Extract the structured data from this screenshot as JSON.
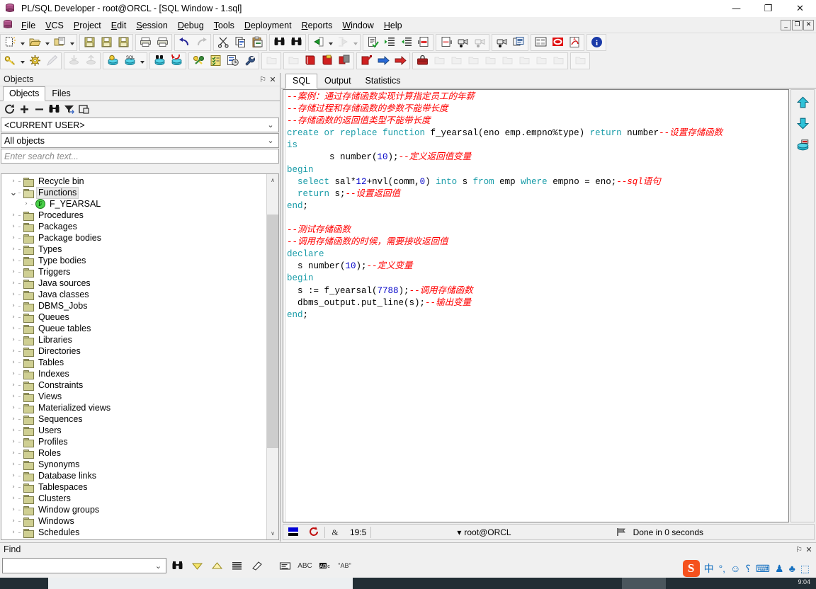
{
  "window": {
    "title": "PL/SQL Developer - root@ORCL - [SQL Window - 1.sql]",
    "minimize": "—",
    "maximize": "❐",
    "close": "✕",
    "mdi_restore": "_",
    "mdi_max": "❐",
    "mdi_close": "✕"
  },
  "menu": [
    {
      "label": "File",
      "accel": "F"
    },
    {
      "label": "VCS",
      "accel": "V"
    },
    {
      "label": "Project",
      "accel": "P"
    },
    {
      "label": "Edit",
      "accel": "E"
    },
    {
      "label": "Session",
      "accel": "S"
    },
    {
      "label": "Debug",
      "accel": "D"
    },
    {
      "label": "Tools",
      "accel": "T"
    },
    {
      "label": "Deployment",
      "accel": "D"
    },
    {
      "label": "Reports",
      "accel": "R"
    },
    {
      "label": "Window",
      "accel": "W"
    },
    {
      "label": "Help",
      "accel": "H"
    }
  ],
  "toolbar_row1": [
    {
      "name": "new-window-icon",
      "enabled": true,
      "dropdown": true
    },
    {
      "name": "open-folder-icon",
      "enabled": true,
      "dropdown": true
    },
    {
      "name": "open-recent-icon",
      "enabled": true,
      "dropdown": true
    },
    {
      "name": "save-icon",
      "enabled": true,
      "dropdown": false
    },
    {
      "name": "save-as-icon",
      "enabled": true,
      "dropdown": false
    },
    {
      "name": "save-all-icon",
      "enabled": true,
      "dropdown": false
    },
    {
      "name": "print-icon",
      "enabled": true,
      "dropdown": false
    },
    {
      "name": "print-setup-icon",
      "enabled": true,
      "dropdown": false
    },
    {
      "name": "undo-icon",
      "enabled": true,
      "dropdown": false
    },
    {
      "name": "redo-icon",
      "enabled": false,
      "dropdown": false
    },
    {
      "name": "cut-icon",
      "enabled": true,
      "dropdown": false
    },
    {
      "name": "copy-icon",
      "enabled": true,
      "dropdown": false
    },
    {
      "name": "paste-icon",
      "enabled": true,
      "dropdown": false
    },
    {
      "name": "find-icon",
      "enabled": true,
      "dropdown": false
    },
    {
      "name": "find-next-icon",
      "enabled": true,
      "dropdown": false
    },
    {
      "name": "previous-window-icon",
      "enabled": true,
      "dropdown": true
    },
    {
      "name": "next-window-icon",
      "enabled": false,
      "dropdown": true
    },
    {
      "name": "syntax-check-icon",
      "enabled": true,
      "dropdown": false
    },
    {
      "name": "indent-icon",
      "enabled": true,
      "dropdown": false
    },
    {
      "name": "unindent-icon",
      "enabled": true,
      "dropdown": false
    },
    {
      "name": "comment-icon",
      "enabled": true,
      "dropdown": false
    },
    {
      "name": "uncomment-icon",
      "enabled": true,
      "dropdown": false
    },
    {
      "name": "record-macro-icon",
      "enabled": true,
      "dropdown": false
    },
    {
      "name": "pause-macro-icon",
      "enabled": false,
      "dropdown": false
    },
    {
      "name": "play-macro-icon",
      "enabled": true,
      "dropdown": false
    },
    {
      "name": "window-list-icon",
      "enabled": true,
      "dropdown": false
    },
    {
      "name": "window-tile-icon",
      "enabled": true,
      "dropdown": false
    },
    {
      "name": "stop-icon",
      "enabled": true,
      "dropdown": false
    },
    {
      "name": "pdf-export-icon",
      "enabled": true,
      "dropdown": false
    },
    {
      "name": "about-info-icon",
      "enabled": true,
      "dropdown": false
    }
  ],
  "toolbar_row2": [
    {
      "name": "login-key-icon",
      "enabled": true,
      "dropdown": true
    },
    {
      "name": "preferences-gear-icon",
      "enabled": true,
      "dropdown": false
    },
    {
      "name": "brush-icon",
      "enabled": false,
      "dropdown": false
    },
    {
      "name": "import-icon",
      "enabled": false,
      "dropdown": false
    },
    {
      "name": "export-icon",
      "enabled": false,
      "dropdown": false
    },
    {
      "name": "new-sql-window-icon",
      "enabled": true,
      "dropdown": false
    },
    {
      "name": "sql-window-icon",
      "enabled": true,
      "dropdown": true
    },
    {
      "name": "explain-plan-icon",
      "enabled": true,
      "dropdown": false
    },
    {
      "name": "rollback-icon",
      "enabled": true,
      "dropdown": false
    },
    {
      "name": "compare-icon",
      "enabled": true,
      "dropdown": false
    },
    {
      "name": "test-script-icon",
      "enabled": true,
      "dropdown": false
    },
    {
      "name": "session-history-icon",
      "enabled": true,
      "dropdown": false
    },
    {
      "name": "tools-wrench-icon",
      "enabled": true,
      "dropdown": false
    },
    {
      "name": "new-object-icon",
      "enabled": false,
      "dropdown": false
    },
    {
      "name": "browse-object-icon",
      "enabled": false,
      "dropdown": false
    },
    {
      "name": "red-book1-icon",
      "enabled": true,
      "dropdown": false
    },
    {
      "name": "red-book2-icon",
      "enabled": true,
      "dropdown": false
    },
    {
      "name": "red-book3-icon",
      "enabled": true,
      "dropdown": false
    },
    {
      "name": "red-book4-icon",
      "enabled": true,
      "dropdown": false
    },
    {
      "name": "step-forward-blue-icon",
      "enabled": true,
      "dropdown": false
    },
    {
      "name": "step-forward-red-icon",
      "enabled": true,
      "dropdown": false
    },
    {
      "name": "toolbox-icon",
      "enabled": true,
      "dropdown": false
    },
    {
      "name": "folder-op1-icon",
      "enabled": false,
      "dropdown": false
    },
    {
      "name": "folder-op2-icon",
      "enabled": false,
      "dropdown": false
    },
    {
      "name": "folder-op3-icon",
      "enabled": false,
      "dropdown": false
    },
    {
      "name": "folder-op4-icon",
      "enabled": false,
      "dropdown": false
    },
    {
      "name": "folder-op5-icon",
      "enabled": false,
      "dropdown": false
    },
    {
      "name": "folder-op6-icon",
      "enabled": false,
      "dropdown": false
    },
    {
      "name": "folder-op7-icon",
      "enabled": false,
      "dropdown": false
    },
    {
      "name": "folder-op8-icon",
      "enabled": false,
      "dropdown": false
    },
    {
      "name": "folder-info-icon",
      "enabled": false,
      "dropdown": false
    },
    {
      "name": "folder-search-icon",
      "enabled": false,
      "dropdown": false
    },
    {
      "name": "folder-dots-icon",
      "enabled": false,
      "dropdown": false
    },
    {
      "name": "folder-next-icon",
      "enabled": false,
      "dropdown": false
    },
    {
      "name": "folder-prev-icon",
      "enabled": false,
      "dropdown": false
    },
    {
      "name": "folder-refresh-icon",
      "enabled": false,
      "dropdown": false
    },
    {
      "name": "folder-go-icon",
      "enabled": false,
      "dropdown": false
    },
    {
      "name": "folder-add-icon",
      "enabled": false,
      "dropdown": false
    },
    {
      "name": "folder-arrow-icon",
      "enabled": false,
      "dropdown": false
    },
    {
      "name": "folder-config-icon",
      "enabled": true,
      "dropdown": false
    }
  ],
  "objects_panel": {
    "title": "Objects",
    "pin_glyph": "⚐",
    "close_glyph": "✕",
    "tabs": [
      {
        "label": "Objects",
        "active": true
      },
      {
        "label": "Files",
        "active": false
      }
    ],
    "toolbar": [
      {
        "name": "refresh-icon"
      },
      {
        "name": "expand-all-icon"
      },
      {
        "name": "collapse-all-icon"
      },
      {
        "name": "find-object-icon"
      },
      {
        "name": "filter-icon"
      },
      {
        "name": "copy-object-icon"
      }
    ],
    "user_filter": {
      "value": "<CURRENT USER>",
      "chevron": "⌄"
    },
    "object_filter": {
      "value": "All objects",
      "chevron": "⌄"
    },
    "search": {
      "value": "",
      "placeholder": "Enter search text..."
    },
    "tree": [
      {
        "label": "Recycle bin",
        "icon": "recycle-bin-icon",
        "expanded": false,
        "depth": 0,
        "selected": false
      },
      {
        "label": "Functions",
        "icon": "folder-open-icon",
        "expanded": true,
        "depth": 0,
        "selected": true
      },
      {
        "label": "F_YEARSAL",
        "icon": "function-icon",
        "expanded": false,
        "depth": 1,
        "selected": false
      },
      {
        "label": "Procedures",
        "icon": "folder-icon",
        "expanded": false,
        "depth": 0,
        "selected": false
      },
      {
        "label": "Packages",
        "icon": "folder-icon",
        "expanded": false,
        "depth": 0,
        "selected": false
      },
      {
        "label": "Package bodies",
        "icon": "folder-icon",
        "expanded": false,
        "depth": 0,
        "selected": false
      },
      {
        "label": "Types",
        "icon": "folder-icon",
        "expanded": false,
        "depth": 0,
        "selected": false
      },
      {
        "label": "Type bodies",
        "icon": "folder-icon",
        "expanded": false,
        "depth": 0,
        "selected": false
      },
      {
        "label": "Triggers",
        "icon": "folder-icon",
        "expanded": false,
        "depth": 0,
        "selected": false
      },
      {
        "label": "Java sources",
        "icon": "folder-icon",
        "expanded": false,
        "depth": 0,
        "selected": false
      },
      {
        "label": "Java classes",
        "icon": "folder-icon",
        "expanded": false,
        "depth": 0,
        "selected": false
      },
      {
        "label": "DBMS_Jobs",
        "icon": "folder-icon",
        "expanded": false,
        "depth": 0,
        "selected": false
      },
      {
        "label": "Queues",
        "icon": "folder-icon",
        "expanded": false,
        "depth": 0,
        "selected": false
      },
      {
        "label": "Queue tables",
        "icon": "folder-icon",
        "expanded": false,
        "depth": 0,
        "selected": false
      },
      {
        "label": "Libraries",
        "icon": "folder-icon",
        "expanded": false,
        "depth": 0,
        "selected": false
      },
      {
        "label": "Directories",
        "icon": "folder-icon",
        "expanded": false,
        "depth": 0,
        "selected": false
      },
      {
        "label": "Tables",
        "icon": "folder-icon",
        "expanded": false,
        "depth": 0,
        "selected": false
      },
      {
        "label": "Indexes",
        "icon": "folder-icon",
        "expanded": false,
        "depth": 0,
        "selected": false
      },
      {
        "label": "Constraints",
        "icon": "folder-icon",
        "expanded": false,
        "depth": 0,
        "selected": false
      },
      {
        "label": "Views",
        "icon": "folder-icon",
        "expanded": false,
        "depth": 0,
        "selected": false
      },
      {
        "label": "Materialized views",
        "icon": "folder-icon",
        "expanded": false,
        "depth": 0,
        "selected": false
      },
      {
        "label": "Sequences",
        "icon": "folder-icon",
        "expanded": false,
        "depth": 0,
        "selected": false
      },
      {
        "label": "Users",
        "icon": "folder-icon",
        "expanded": false,
        "depth": 0,
        "selected": false
      },
      {
        "label": "Profiles",
        "icon": "folder-icon",
        "expanded": false,
        "depth": 0,
        "selected": false
      },
      {
        "label": "Roles",
        "icon": "folder-icon",
        "expanded": false,
        "depth": 0,
        "selected": false
      },
      {
        "label": "Synonyms",
        "icon": "folder-icon",
        "expanded": false,
        "depth": 0,
        "selected": false
      },
      {
        "label": "Database links",
        "icon": "folder-icon",
        "expanded": false,
        "depth": 0,
        "selected": false
      },
      {
        "label": "Tablespaces",
        "icon": "folder-icon",
        "expanded": false,
        "depth": 0,
        "selected": false
      },
      {
        "label": "Clusters",
        "icon": "folder-icon",
        "expanded": false,
        "depth": 0,
        "selected": false
      },
      {
        "label": "Window groups",
        "icon": "folder-icon",
        "expanded": false,
        "depth": 0,
        "selected": false
      },
      {
        "label": "Windows",
        "icon": "folder-icon",
        "expanded": false,
        "depth": 0,
        "selected": false
      },
      {
        "label": "Schedules",
        "icon": "folder-icon",
        "expanded": false,
        "depth": 0,
        "selected": false
      }
    ],
    "scroll_up_glyph": "∧",
    "scroll_down_glyph": "∨"
  },
  "sql_window": {
    "tabs": [
      {
        "label": "SQL",
        "active": true
      },
      {
        "label": "Output",
        "active": false
      },
      {
        "label": "Statistics",
        "active": false
      }
    ],
    "code_lines": [
      [
        {
          "t": "--案例：通过存储函数实现计算指定员工的年薪",
          "c": "cm"
        }
      ],
      [
        {
          "t": "--存储过程和存储函数的参数不能带长度",
          "c": "cm"
        }
      ],
      [
        {
          "t": "--存储函数的返回值类型不能带长度",
          "c": "cm"
        }
      ],
      [
        {
          "t": "create or replace function",
          "c": "kw"
        },
        {
          "t": " f_yearsal(eno emp.empno%type) ",
          "c": "plain"
        },
        {
          "t": "return",
          "c": "kw"
        },
        {
          "t": " number",
          "c": "plain"
        },
        {
          "t": "--设置存储函数",
          "c": "cm"
        }
      ],
      [
        {
          "t": "is",
          "c": "kw"
        }
      ],
      [
        {
          "t": "        s number(",
          "c": "plain"
        },
        {
          "t": "10",
          "c": "num"
        },
        {
          "t": ");",
          "c": "plain"
        },
        {
          "t": "--定义返回值变量",
          "c": "cm"
        }
      ],
      [
        {
          "t": "begin",
          "c": "kw"
        }
      ],
      [
        {
          "t": "  ",
          "c": "plain"
        },
        {
          "t": "select",
          "c": "kw"
        },
        {
          "t": " sal*",
          "c": "plain"
        },
        {
          "t": "12",
          "c": "num"
        },
        {
          "t": "+nvl(comm,",
          "c": "plain"
        },
        {
          "t": "0",
          "c": "num"
        },
        {
          "t": ") ",
          "c": "plain"
        },
        {
          "t": "into",
          "c": "kw"
        },
        {
          "t": " s ",
          "c": "plain"
        },
        {
          "t": "from",
          "c": "kw"
        },
        {
          "t": " emp ",
          "c": "plain"
        },
        {
          "t": "where",
          "c": "kw"
        },
        {
          "t": " empno = eno;",
          "c": "plain"
        },
        {
          "t": "--sql语句",
          "c": "cm"
        }
      ],
      [
        {
          "t": "  ",
          "c": "plain"
        },
        {
          "t": "return",
          "c": "kw"
        },
        {
          "t": " s;",
          "c": "plain"
        },
        {
          "t": "--设置返回值",
          "c": "cm"
        }
      ],
      [
        {
          "t": "end",
          "c": "kw"
        },
        {
          "t": ";",
          "c": "plain"
        }
      ],
      [
        {
          "t": "",
          "c": "plain"
        }
      ],
      [
        {
          "t": "--测试存储函数",
          "c": "cm"
        }
      ],
      [
        {
          "t": "--调用存储函数的时候，需要接收返回值",
          "c": "cm"
        }
      ],
      [
        {
          "t": "declare",
          "c": "kw"
        }
      ],
      [
        {
          "t": "  s number(",
          "c": "plain"
        },
        {
          "t": "10",
          "c": "num"
        },
        {
          "t": ");",
          "c": "plain"
        },
        {
          "t": "--定义变量",
          "c": "cm"
        }
      ],
      [
        {
          "t": "begin",
          "c": "kw"
        }
      ],
      [
        {
          "t": "  s := f_yearsal(",
          "c": "plain"
        },
        {
          "t": "7788",
          "c": "num"
        },
        {
          "t": ");",
          "c": "plain"
        },
        {
          "t": "--调用存储函数",
          "c": "cm"
        }
      ],
      [
        {
          "t": "  dbms_output.put_line(s);",
          "c": "plain"
        },
        {
          "t": "--输出变量",
          "c": "cm"
        }
      ],
      [
        {
          "t": "end",
          "c": "kw"
        },
        {
          "t": ";",
          "c": "plain"
        }
      ]
    ],
    "side_buttons": [
      {
        "name": "scroll-to-top-icon"
      },
      {
        "name": "scroll-to-bottom-icon"
      },
      {
        "name": "execute-statement-icon"
      }
    ],
    "status": {
      "cursor_position": "19:5",
      "connection": "root@ORCL",
      "connection_chevron": "▾",
      "result": "Done in 0 seconds"
    }
  },
  "find_panel": {
    "title": "Find",
    "pin_glyph": "⚐",
    "close_glyph": "✕",
    "input": {
      "value": "",
      "placeholder": "",
      "chevron": "⌄"
    },
    "buttons": [
      {
        "name": "find-binoculars-icon"
      },
      {
        "name": "find-next-down-icon"
      },
      {
        "name": "find-previous-up-icon"
      },
      {
        "name": "find-all-list-icon"
      },
      {
        "name": "clear-highlight-eraser-icon"
      },
      {
        "name": "find-in-comments-icon"
      },
      {
        "name": "match-case-abc-icon"
      },
      {
        "name": "highlight-all-icon"
      },
      {
        "name": "whole-word-icon"
      }
    ],
    "whole_word_label": "\"AB\"",
    "match_case_label": "ABC"
  },
  "ime_tray": {
    "logo": "S",
    "items": [
      {
        "name": "ime-mode-chinese",
        "glyph": "中"
      },
      {
        "name": "ime-punctuation",
        "glyph": "°,"
      },
      {
        "name": "ime-emoji",
        "glyph": "☺"
      },
      {
        "name": "ime-voice-input",
        "glyph": "⸮"
      },
      {
        "name": "ime-soft-keyboard",
        "glyph": "⌨"
      },
      {
        "name": "ime-user-profile",
        "glyph": "♟"
      },
      {
        "name": "ime-skin",
        "glyph": "♣"
      },
      {
        "name": "ime-toolbox",
        "glyph": "⬚"
      }
    ]
  },
  "taskbar": {
    "clock": "9:04"
  },
  "colors": {
    "keyword": "#1a9ca8",
    "comment": "#ff0000",
    "number": "#0000c8",
    "accent": "#1570c0",
    "sogou_orange": "#f5511d"
  }
}
